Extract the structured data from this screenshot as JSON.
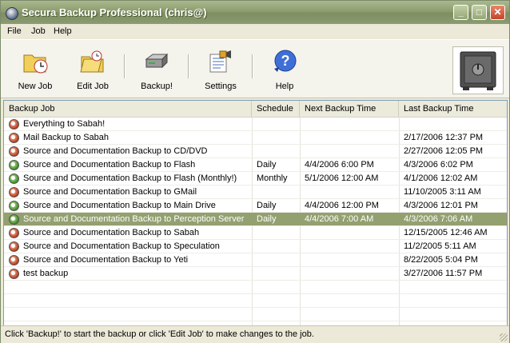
{
  "window": {
    "title": "Secura Backup Professional (chris@)"
  },
  "menu": [
    "File",
    "Job",
    "Help"
  ],
  "toolbar": {
    "new_job": "New Job",
    "edit_job": "Edit Job",
    "backup": "Backup!",
    "settings": "Settings",
    "help": "Help"
  },
  "columns": {
    "job": "Backup Job",
    "schedule": "Schedule",
    "next": "Next Backup Time",
    "last": "Last Backup Time"
  },
  "rows": [
    {
      "job": "Everything to Sabah!",
      "schedule": "",
      "next": "",
      "last": "",
      "status": "red"
    },
    {
      "job": "Mail Backup to Sabah",
      "schedule": "",
      "next": "",
      "last": "2/17/2006 12:37 PM",
      "status": "red"
    },
    {
      "job": "Source and Documentation Backup to CD/DVD",
      "schedule": "",
      "next": "",
      "last": "2/27/2006 12:05 PM",
      "status": "red"
    },
    {
      "job": "Source and Documentation Backup to Flash",
      "schedule": "Daily",
      "next": "4/4/2006 6:00 PM",
      "last": "4/3/2006 6:02 PM",
      "status": "green"
    },
    {
      "job": "Source and Documentation Backup to Flash (Monthly!)",
      "schedule": "Monthly",
      "next": "5/1/2006 12:00 AM",
      "last": "4/1/2006 12:02 AM",
      "status": "green"
    },
    {
      "job": "Source and Documentation Backup to GMail",
      "schedule": "",
      "next": "",
      "last": "11/10/2005 3:11 AM",
      "status": "red"
    },
    {
      "job": "Source and Documentation Backup to Main Drive",
      "schedule": "Daily",
      "next": "4/4/2006 12:00 PM",
      "last": "4/3/2006 12:01 PM",
      "status": "green"
    },
    {
      "job": "Source and Documentation Backup to Perception Server",
      "schedule": "Daily",
      "next": "4/4/2006 7:00 AM",
      "last": "4/3/2006 7:06 AM",
      "status": "green",
      "selected": true
    },
    {
      "job": "Source and Documentation Backup to Sabah",
      "schedule": "",
      "next": "",
      "last": "12/15/2005 12:46 AM",
      "status": "red"
    },
    {
      "job": "Source and Documentation Backup to Speculation",
      "schedule": "",
      "next": "",
      "last": "11/2/2005 5:11 AM",
      "status": "red"
    },
    {
      "job": "Source and Documentation Backup to Yeti",
      "schedule": "",
      "next": "",
      "last": "8/22/2005 5:04 PM",
      "status": "red"
    },
    {
      "job": "test backup",
      "schedule": "",
      "next": "",
      "last": "3/27/2006 11:57 PM",
      "status": "red"
    }
  ],
  "status_bar": "Click 'Backup!' to start the backup or click 'Edit Job' to make changes to the job.",
  "icons": {
    "new_job": "new-job-icon",
    "edit_job": "edit-job-icon",
    "backup": "drive-icon",
    "settings": "settings-icon",
    "help": "help-icon",
    "logo": "safe-icon"
  },
  "colors": {
    "titlebar": "#8d9d70",
    "selection": "#93a070"
  }
}
